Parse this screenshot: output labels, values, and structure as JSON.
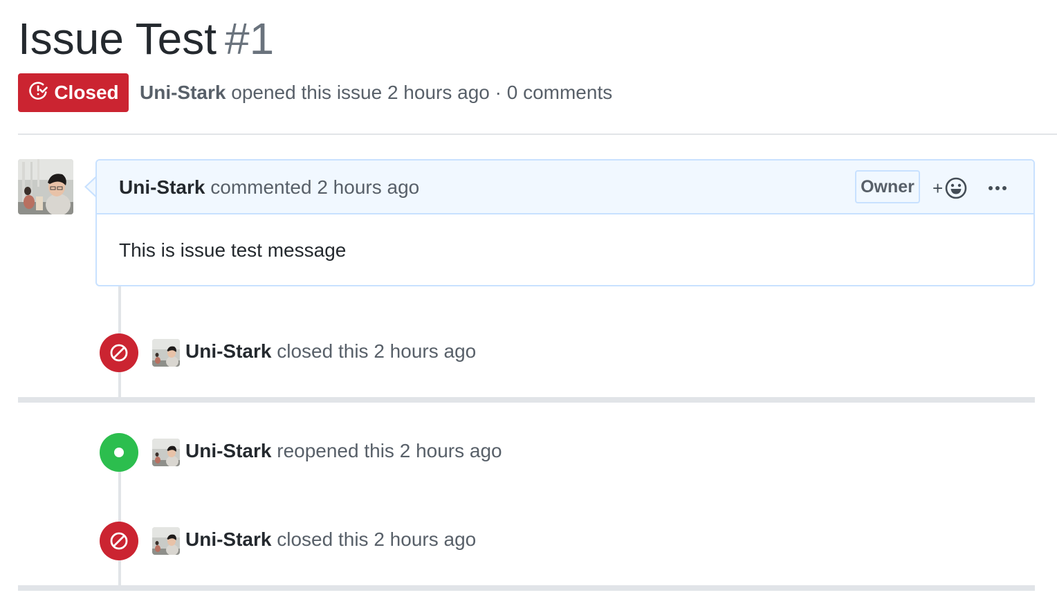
{
  "issue": {
    "title": "Issue Test",
    "number": "#1",
    "state_label": "Closed",
    "author": "Uni-Stark",
    "meta_text": "opened this issue 2 hours ago · 0 comments"
  },
  "comment": {
    "author": "Uni-Stark",
    "action": "commented 2 hours ago",
    "role_badge": "Owner",
    "reaction_plus": "+",
    "body": "This is issue test message"
  },
  "events": [
    {
      "type": "closed",
      "author": "Uni-Stark",
      "text": "closed this 2 hours ago"
    },
    {
      "type": "reopened",
      "author": "Uni-Stark",
      "text": "reopened this 2 hours ago"
    },
    {
      "type": "closed",
      "author": "Uni-Stark",
      "text": "closed this 2 hours ago"
    }
  ],
  "colors": {
    "closed": "#cb2431",
    "reopened": "#2cbe4e",
    "comment_border": "#c8e1ff",
    "comment_header_bg": "#f1f8ff",
    "muted_text": "#586069",
    "timeline": "#e1e4e8"
  },
  "icons": {
    "state": "issue-closed-icon",
    "reaction": "smiley-icon",
    "more": "kebab-horizontal-icon",
    "closed_event": "circle-slash-icon",
    "reopened_event": "primitive-dot-icon"
  }
}
